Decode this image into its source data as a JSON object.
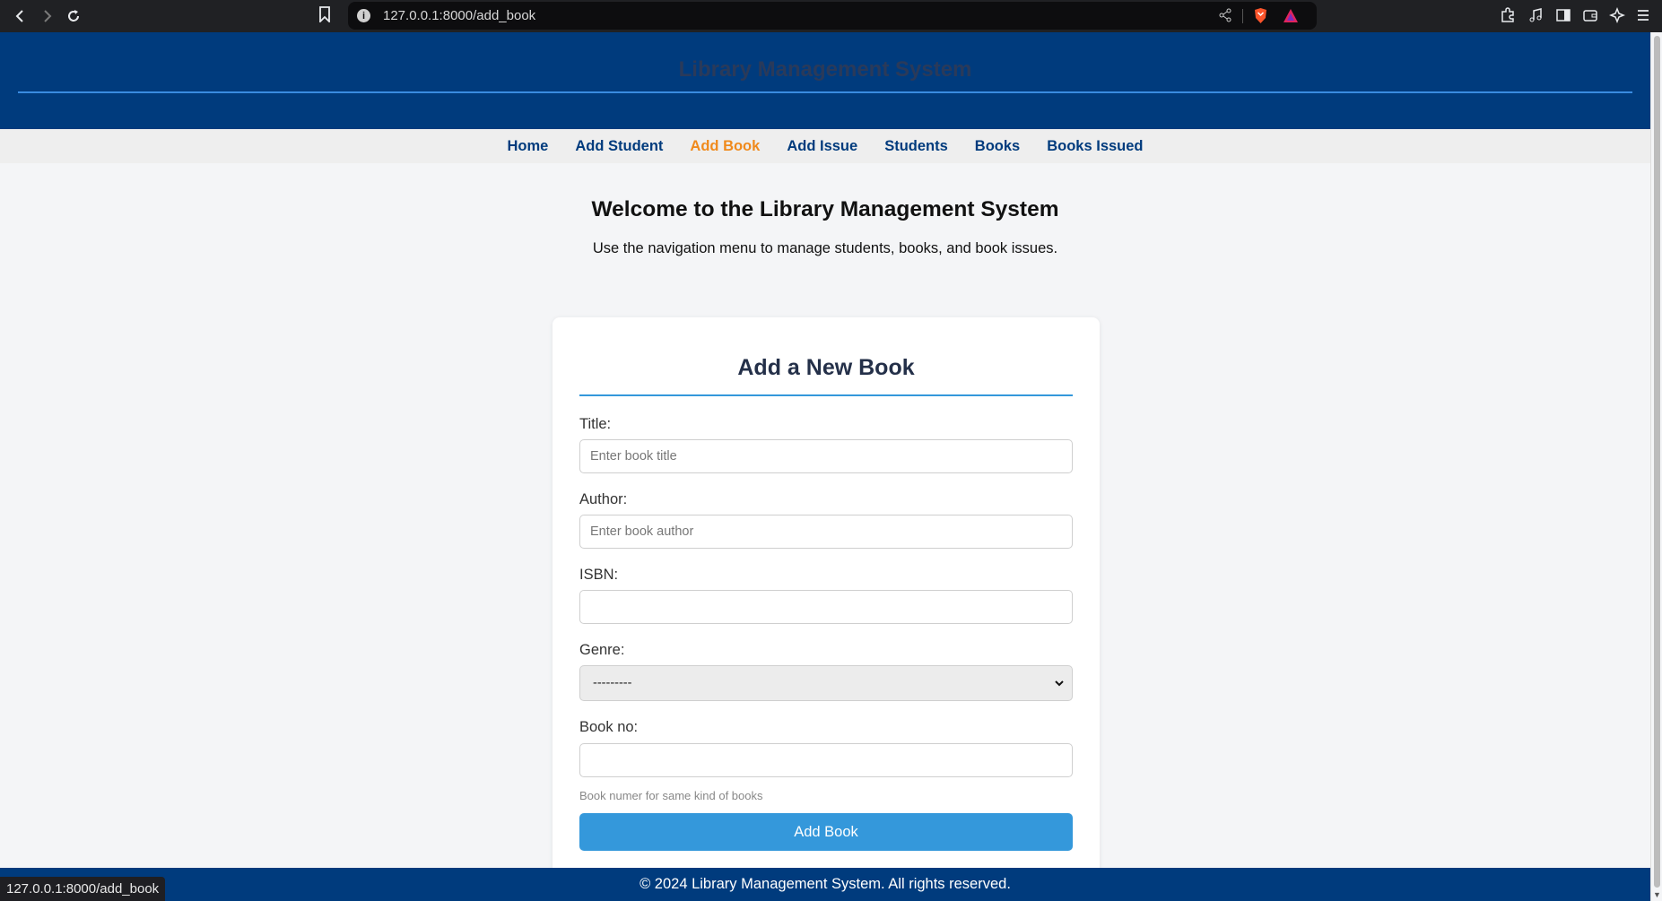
{
  "browser": {
    "url": "127.0.0.1:8000/add_book",
    "info_glyph": "i",
    "icons": [
      "back-icon",
      "forward-icon",
      "reload-icon",
      "bookmark-icon",
      "site-info-icon",
      "share-icon",
      "brave-shield-icon",
      "brave-rewards-icon",
      "extensions-icon",
      "media-icon",
      "sidebar-icon",
      "wallet-icon",
      "leo-ai-icon",
      "menu-icon"
    ]
  },
  "header": {
    "site_title": "Library Management System"
  },
  "nav": {
    "items": [
      {
        "label": "Home",
        "active": false
      },
      {
        "label": "Add Student",
        "active": false
      },
      {
        "label": "Add Book",
        "active": true
      },
      {
        "label": "Add Issue",
        "active": false
      },
      {
        "label": "Students",
        "active": false
      },
      {
        "label": "Books",
        "active": false
      },
      {
        "label": "Books Issued",
        "active": false
      }
    ]
  },
  "intro": {
    "heading": "Welcome to the Library Management System",
    "text": "Use the navigation menu to manage students, books, and book issues."
  },
  "form": {
    "title": "Add a New Book",
    "title_label": "Title:",
    "title_placeholder": "Enter book title",
    "title_value": "",
    "author_label": "Author:",
    "author_placeholder": "Enter book author",
    "author_value": "",
    "isbn_label": "ISBN:",
    "isbn_value": "",
    "genre_label": "Genre:",
    "genre_selected": "---------",
    "bookno_label": "Book no:",
    "bookno_value": "",
    "bookno_help": "Book numer for same kind of books",
    "submit_label": "Add Book"
  },
  "footer": {
    "text": "© 2024 Library Management System. All rights reserved."
  },
  "status_bar": {
    "hover_url": "127.0.0.1:8000/add_book"
  },
  "colors": {
    "header_bg": "#003b7d",
    "nav_active": "#f08a1c",
    "nav_link": "#003b7d",
    "button": "#3498db",
    "page_bg": "#f4f5f7"
  }
}
